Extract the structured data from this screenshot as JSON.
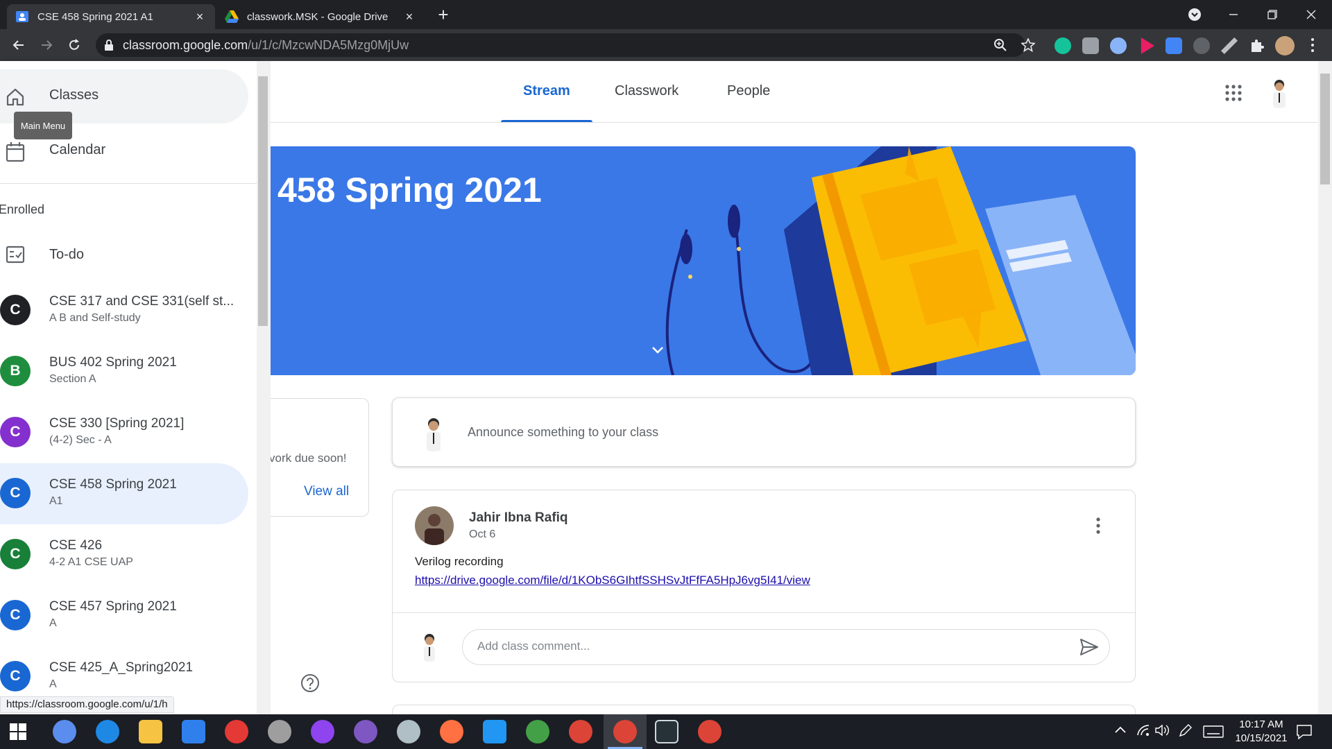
{
  "browser": {
    "tabs": [
      {
        "title": "CSE 458 Spring 2021 A1",
        "active": true
      },
      {
        "title": "classwork.MSK - Google Drive",
        "active": false
      }
    ],
    "new_tab_symbol": "+",
    "close_symbol": "×",
    "url_host": "classroom.google.com",
    "url_path": "/u/1/c/MzcwNDA5Mzg0MjUw",
    "status_url": "https://classroom.google.com/u/1/h"
  },
  "classroom": {
    "tabs": [
      "Stream",
      "Classwork",
      "People"
    ],
    "active_tab": "Stream",
    "banner_title": "458 Spring 2021",
    "upcoming": {
      "text": "vork due soon!",
      "link": "View all"
    },
    "announce_placeholder": "Announce something to your class",
    "post": {
      "author": "Jahir Ibna Rafiq",
      "date": "Oct 6",
      "text": "Verilog recording",
      "link": "https://drive.google.com/file/d/1KObS6GIhtfSSHSvJtFfFA5HpJ6vg5I41/view"
    },
    "comment_placeholder": "Add class comment..."
  },
  "sidebar": {
    "classes_label": "Classes",
    "tooltip": "Main Menu",
    "calendar_label": "Calendar",
    "section_label": "Enrolled",
    "todo_label": "To-do",
    "courses": [
      {
        "letter": "C",
        "name": "CSE 317 and CSE 331(self st...",
        "sub": "A B and Self-study",
        "color": "#202124"
      },
      {
        "letter": "B",
        "name": "BUS 402 Spring 2021",
        "sub": "Section A",
        "color": "#1e8e3e"
      },
      {
        "letter": "C",
        "name": "CSE 330 [Spring 2021]",
        "sub": "(4-2) Sec - A",
        "color": "#8430ce"
      },
      {
        "letter": "C",
        "name": "CSE 458 Spring 2021",
        "sub": "A1",
        "color": "#1967d2"
      },
      {
        "letter": "C",
        "name": "CSE 426",
        "sub": "4-2 A1 CSE UAP",
        "color": "#188038"
      },
      {
        "letter": "C",
        "name": "CSE 457 Spring 2021",
        "sub": "A",
        "color": "#1967d2"
      },
      {
        "letter": "C",
        "name": "CSE 425_A_Spring2021",
        "sub": "A",
        "color": "#1967d2"
      }
    ],
    "selected_index": 3
  },
  "taskbar": {
    "time": "10:17 AM",
    "date": "10/15/2021"
  },
  "colors": {
    "accent": "#1967d2",
    "banner": "#3b78e7",
    "selected_bg": "#e8f0fe"
  }
}
